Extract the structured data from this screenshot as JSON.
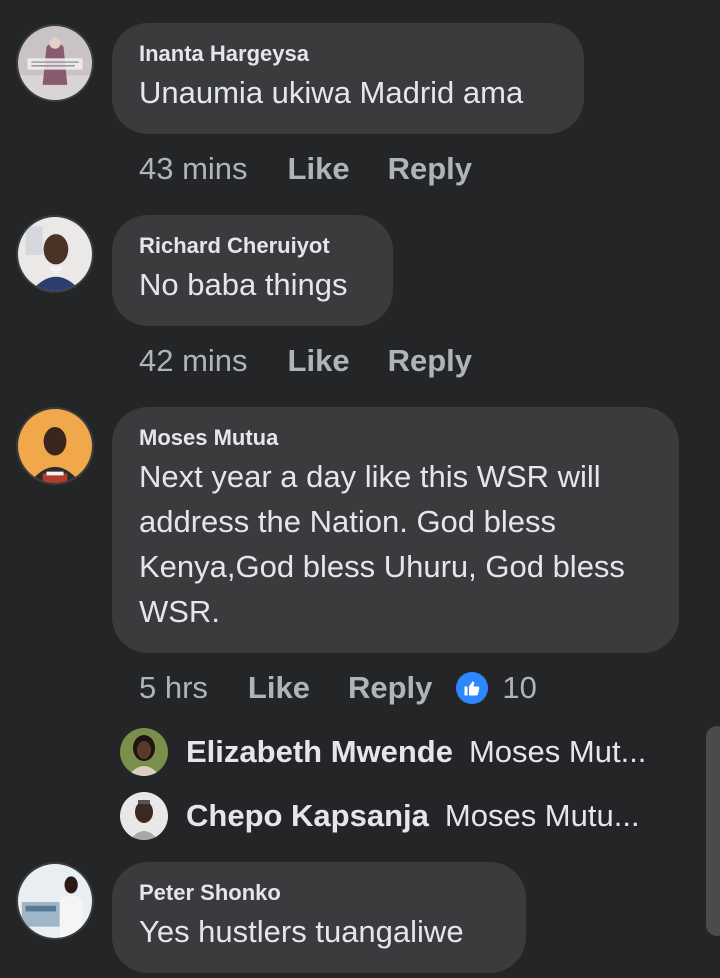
{
  "comments": [
    {
      "author": "Inanta Hargeysa",
      "text": "Unaumia ukiwa Madrid ama",
      "time": "43 mins",
      "like": "Like",
      "reply": "Reply"
    },
    {
      "author": "Richard Cheruiyot",
      "text": "No baba things",
      "time": "42 mins",
      "like": "Like",
      "reply": "Reply"
    },
    {
      "author": "Moses Mutua",
      "text_lines": [
        "Next year a day like this WSR will",
        "address the Nation. God bless",
        "Kenya,God bless Uhuru, God bless",
        "WSR."
      ],
      "time": "5 hrs",
      "like": "Like",
      "reply": "Reply",
      "reaction_count": "10",
      "replies": [
        {
          "author": "Elizabeth Mwende",
          "snippet": "Moses Mut..."
        },
        {
          "author": "Chepo Kapsanja",
          "snippet": "Moses Mutu..."
        }
      ]
    },
    {
      "author": "Peter Shonko",
      "text": "Yes hustlers tuangaliwe"
    }
  ],
  "colors": {
    "background": "#242526",
    "bubble": "#3a3b3c",
    "text": "#e4e6eb",
    "muted": "#b0b3b8",
    "like_badge": "#2d88ff"
  }
}
